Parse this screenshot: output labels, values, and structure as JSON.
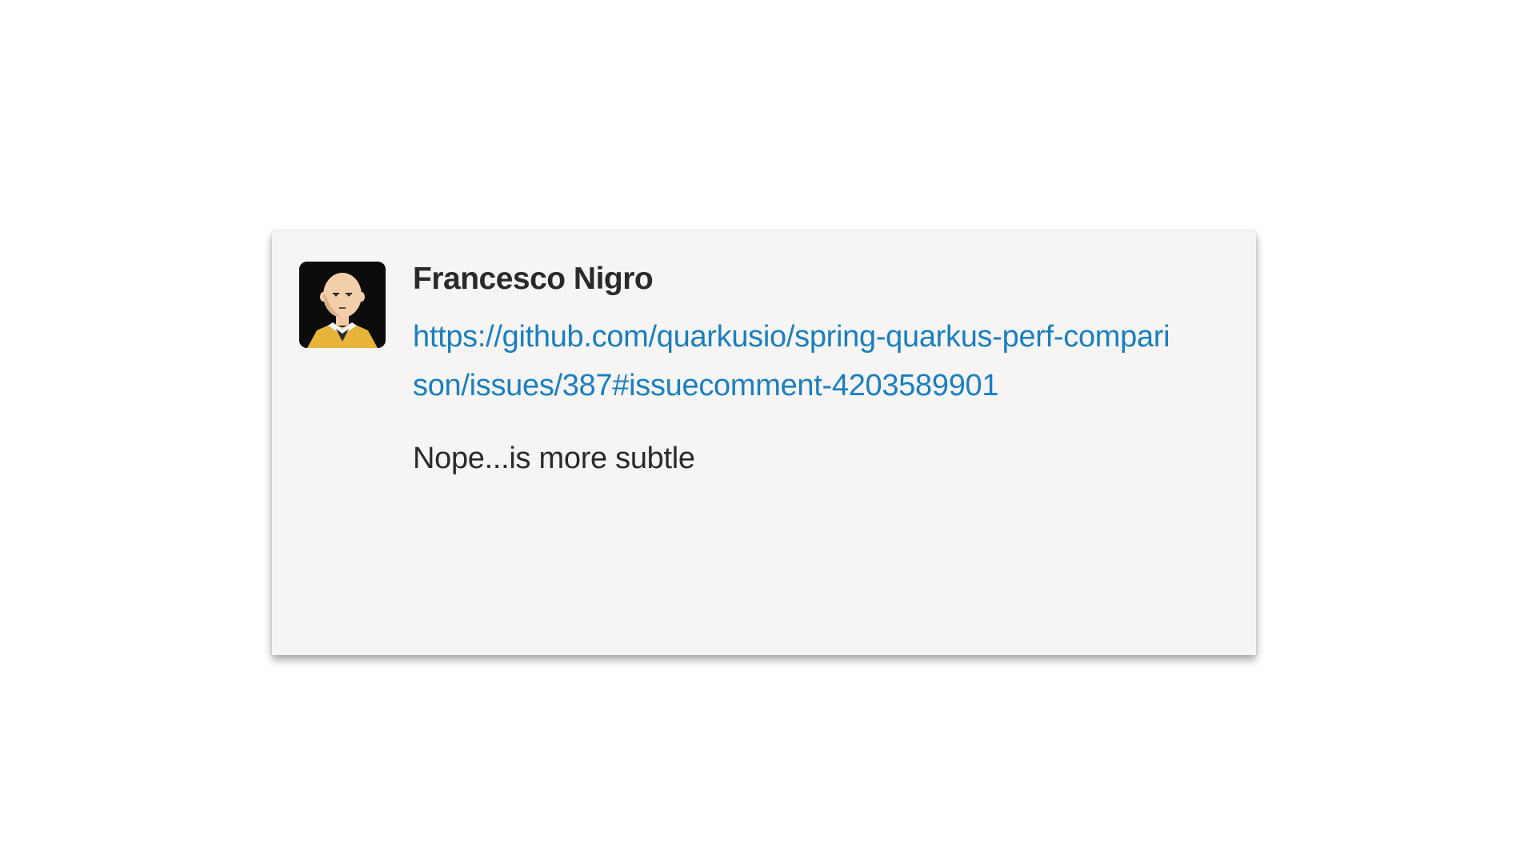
{
  "post": {
    "author": "Francesco Nigro",
    "avatar_icon": "bald-hero-avatar",
    "link_text": "https://github.com/quarkusio/spring-quarkus-perf-comparison/issues/387#issuecomment-4203589901",
    "message": "Nope...is more subtle"
  },
  "colors": {
    "link": "#1a7fbf",
    "text": "#2a2a2a",
    "card_background": "#f6f5f3"
  }
}
